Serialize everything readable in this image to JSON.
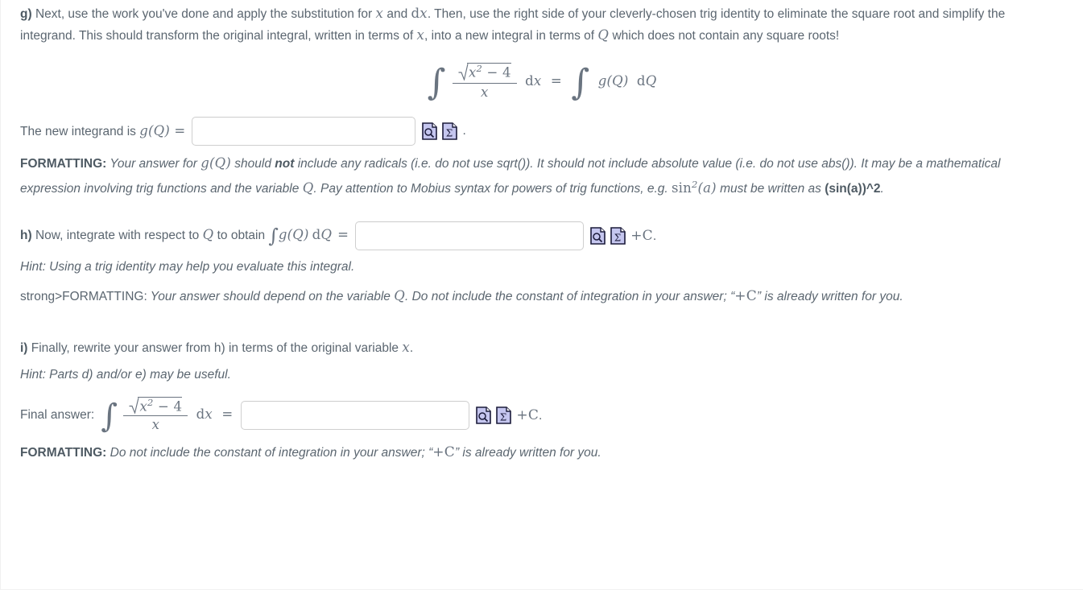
{
  "colors": {
    "text": "#5b6670",
    "math": "#6a7480",
    "icon_fill": "#c5c6ef",
    "icon_border": "#1b1b3a",
    "input_border": "#cfcfcf"
  },
  "part_g": {
    "marker": "g)",
    "text": " Next, use the work you've done and apply the substitution for ",
    "text2": " and ",
    "text3": ".  Then, use the right side of your cleverly-chosen trig identity to eliminate the square root and simplify the integrand.  This should transform the original integral, written in terms of ",
    "text4": ", into a new integral in terms of ",
    "text5": " which does not contain any square roots!",
    "var_x": "x",
    "var_dx": "dx",
    "var_Q": "Q",
    "equation": {
      "integral_sign": "∫",
      "numerator_radicand": "x",
      "numerator_exponent": "2",
      "numerator_rest": "− 4",
      "denominator": "x",
      "differential": "dx",
      "equals": "=",
      "rhs_function": "g(Q)",
      "rhs_differential": "dQ",
      "alt_text": "∫ √(x² − 4)/x dx = ∫ g(Q) dQ"
    },
    "answer_label_pre": "The new integrand is ",
    "answer_label_fn": "g(Q)",
    "answer_label_eq": " =",
    "answer_value": "",
    "answer_placeholder": "",
    "trailing": ".",
    "formatting_bold": "FORMATTING:",
    "formatting_1": " Your answer for ",
    "formatting_fn": "g(Q)",
    "formatting_2": " should ",
    "formatting_not": "not",
    "formatting_3": " include any radicals (i.e. do not use sqrt()). It should not include absolute value (i.e. do not use abs()).  It may be a mathematical expression involving trig functions and the variable ",
    "formatting_var": "Q",
    "formatting_4": ". Pay attention to Mobius syntax for powers of trig functions, e.g. ",
    "formatting_sin": "sin",
    "formatting_sin_exp": "2",
    "formatting_sin_arg": "(a)",
    "formatting_5": " must be written as ",
    "formatting_code": "(sin(a))^2",
    "formatting_6": "."
  },
  "part_h": {
    "marker": "h)",
    "text": " Now, integrate with respect to ",
    "var_Q": "Q",
    "text2": " to obtain ",
    "integral_expr": "∫ g(Q) dQ",
    "integral_sign": "∫",
    "integral_fn": "g(Q)",
    "integral_d": "dQ",
    "equals": "=",
    "answer_value": "",
    "answer_placeholder": "",
    "plus_c": "+C",
    "trailing": ".",
    "hint_label": "Hint:",
    "hint_text": " Using a trig identity may help you evaluate this integral.",
    "formatting_raw": "strong>FORMATTING:",
    "formatting_1": " Your answer should depend on the variable ",
    "formatting_var": "Q",
    "formatting_2": ".  Do not include the constant of integration in your answer; “",
    "formatting_plusc": "+C",
    "formatting_3": "” is already written for you."
  },
  "part_i": {
    "marker": "i)",
    "text": " Finally, rewrite your answer from h) in terms of the original variable ",
    "var_x": "x",
    "text2": ".",
    "hint_label": "Hint:",
    "hint_text": " Parts d) and/or e) may be useful.",
    "final_label": "Final answer:",
    "equation": {
      "integral_sign": "∫",
      "numerator_radicand": "x",
      "numerator_exponent": "2",
      "numerator_rest": "− 4",
      "denominator": "x",
      "differential": "dx",
      "equals": "=",
      "alt_text": "∫ √(x² − 4)/x dx ="
    },
    "answer_value": "",
    "answer_placeholder": "",
    "plus_c": "+C",
    "trailing": ".",
    "formatting_bold": "FORMATTING:",
    "formatting_1": " Do not include the constant of integration in your answer; “",
    "formatting_plusc": "+C",
    "formatting_2": "”  is already written for you."
  },
  "icons": {
    "preview": "preview-magnifier-icon",
    "palette": "math-sigma-palette-icon",
    "preview_glyph": "⌕",
    "palette_glyph": "Σ"
  }
}
